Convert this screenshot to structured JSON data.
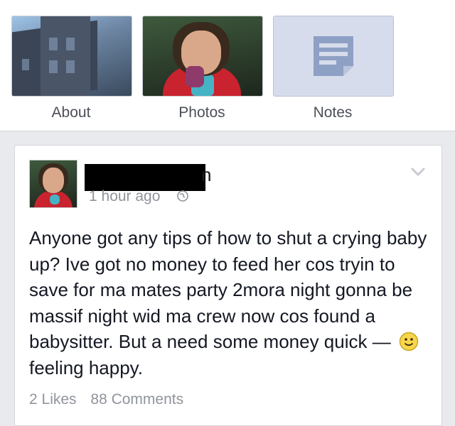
{
  "profile_tabs": [
    {
      "label": "About"
    },
    {
      "label": "Photos"
    },
    {
      "label": "Notes"
    }
  ],
  "post": {
    "author_name_visible": "n",
    "timestamp": "1 hour ago",
    "text": "Anyone got any tips of how to shut a crying baby up? Ive got no money to feed her cos tryin to save for ma mates party 2mora night gonna be massif night wid ma crew now cos found a babysitter. But a need some money quick —",
    "feeling": "feeling happy.",
    "likes": "2 Likes",
    "comments": "88 Comments"
  },
  "colors": {
    "background": "#e9eaed",
    "text": "#141823",
    "muted": "#90949c",
    "notes_tile": "#d6dceb"
  }
}
